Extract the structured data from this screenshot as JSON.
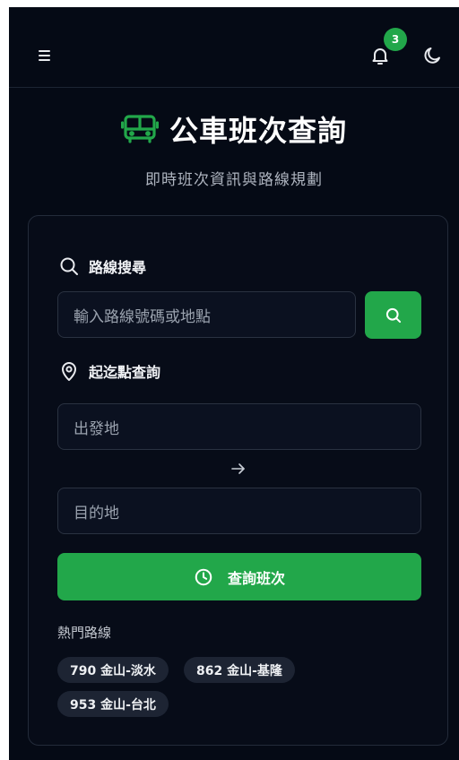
{
  "header": {
    "notification_count": "3",
    "icons": {
      "menu": "menu-icon",
      "bell": "bell-icon",
      "theme": "moon-icon"
    }
  },
  "hero": {
    "title": "公車班次查詢",
    "subtitle": "即時班次資訊與路線規劃",
    "icon": "bus-icon",
    "accent_color": "#22a74a"
  },
  "route_search": {
    "heading": "路線搜尋",
    "placeholder": "輸入路線號碼或地點"
  },
  "trip_search": {
    "heading": "起迄點查詢",
    "origin_placeholder": "出發地",
    "destination_placeholder": "目的地",
    "submit_label": "查詢班次"
  },
  "popular": {
    "label": "熱門路線",
    "routes": [
      {
        "label": "790 金山-淡水"
      },
      {
        "label": "862 金山-基隆"
      },
      {
        "label": "953 金山-台北"
      }
    ]
  },
  "colors": {
    "background": "#050a15",
    "primary": "#22a74a",
    "card_border": "#232b3a"
  }
}
